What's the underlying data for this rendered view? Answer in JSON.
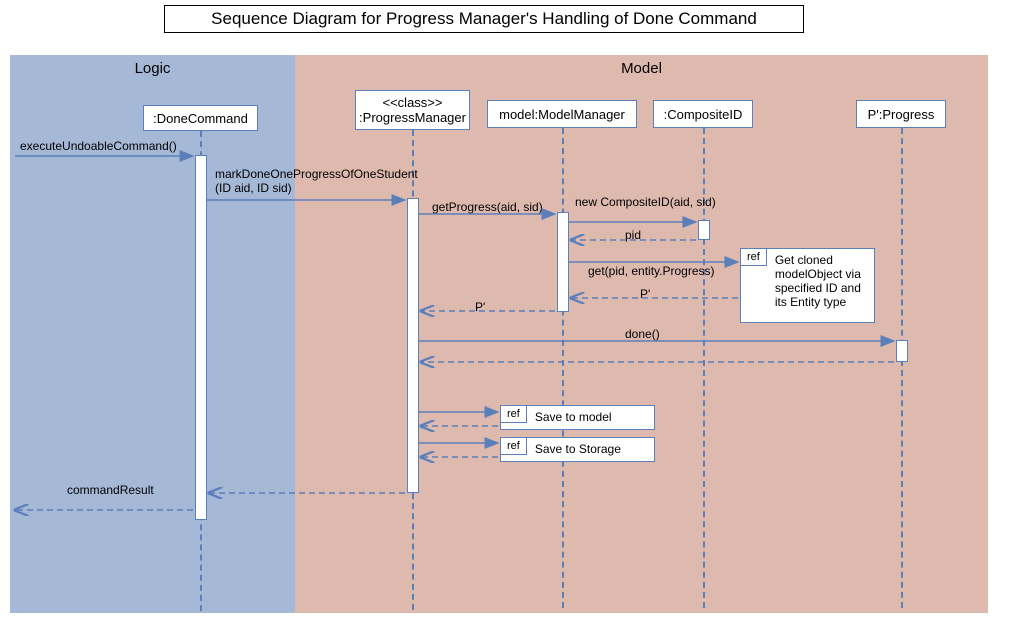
{
  "title": "Sequence Diagram for Progress Manager's Handling of Done Command",
  "regions": {
    "logic": "Logic",
    "model": "Model"
  },
  "participants": {
    "doneCommand": ":DoneCommand",
    "progressManager": "<<class>>\n:ProgressManager",
    "modelManager": "model:ModelManager",
    "compositeId": ":CompositeID",
    "progress": "P':Progress"
  },
  "messages": {
    "execute": "executeUndoableCommand()",
    "markDone": "markDoneOneProgressOfOneStudent\n(ID aid, ID sid)",
    "getProgress": "getProgress(aid, sid)",
    "newComposite": "new CompositeID(aid, sid)",
    "pid": "pid",
    "get": "get(pid, entity.Progress)",
    "pprime1": "P'",
    "pprime2": "P'",
    "done": "done()",
    "commandResult": "commandResult"
  },
  "refs": {
    "cloned": "Get cloned modelObject via specified ID and its Entity type",
    "saveModel": "Save to model",
    "saveStorage": "Save to Storage",
    "tag": "ref"
  },
  "chart_data": {
    "type": "sequence_diagram",
    "title": "Sequence Diagram for Progress Manager's Handling of Done Command",
    "regions": [
      {
        "name": "Logic",
        "participants": [
          ":DoneCommand"
        ]
      },
      {
        "name": "Model",
        "participants": [
          "<<class>> :ProgressManager",
          "model:ModelManager",
          ":CompositeID",
          "P':Progress"
        ]
      }
    ],
    "participants": [
      ":DoneCommand",
      "<<class>> :ProgressManager",
      "model:ModelManager",
      ":CompositeID",
      "P':Progress"
    ],
    "messages": [
      {
        "from": "(caller)",
        "to": ":DoneCommand",
        "label": "executeUndoableCommand()",
        "type": "call"
      },
      {
        "from": ":DoneCommand",
        "to": ":ProgressManager",
        "label": "markDoneOneProgressOfOneStudent(ID aid, ID sid)",
        "type": "call"
      },
      {
        "from": ":ProgressManager",
        "to": "model:ModelManager",
        "label": "getProgress(aid, sid)",
        "type": "call"
      },
      {
        "from": "model:ModelManager",
        "to": ":CompositeID",
        "label": "new CompositeID(aid, sid)",
        "type": "create"
      },
      {
        "from": ":CompositeID",
        "to": "model:ModelManager",
        "label": "pid",
        "type": "return"
      },
      {
        "from": "model:ModelManager",
        "to": "ref",
        "label": "get(pid, entity.Progress)",
        "ref": "Get cloned modelObject via specified ID and its Entity type",
        "type": "call"
      },
      {
        "from": "ref",
        "to": "model:ModelManager",
        "label": "P'",
        "type": "return"
      },
      {
        "from": "model:ModelManager",
        "to": ":ProgressManager",
        "label": "P'",
        "type": "return"
      },
      {
        "from": ":ProgressManager",
        "to": "P':Progress",
        "label": "done()",
        "type": "call"
      },
      {
        "from": "P':Progress",
        "to": ":ProgressManager",
        "label": "",
        "type": "return"
      },
      {
        "from": ":ProgressManager",
        "to": "ref",
        "ref": "Save to model",
        "type": "call"
      },
      {
        "from": "ref",
        "to": ":ProgressManager",
        "type": "return"
      },
      {
        "from": ":ProgressManager",
        "to": "ref",
        "ref": "Save to Storage",
        "type": "call"
      },
      {
        "from": "ref",
        "to": ":ProgressManager",
        "type": "return"
      },
      {
        "from": ":ProgressManager",
        "to": ":DoneCommand",
        "label": "",
        "type": "return"
      },
      {
        "from": ":DoneCommand",
        "to": "(caller)",
        "label": "commandResult",
        "type": "return"
      }
    ]
  }
}
